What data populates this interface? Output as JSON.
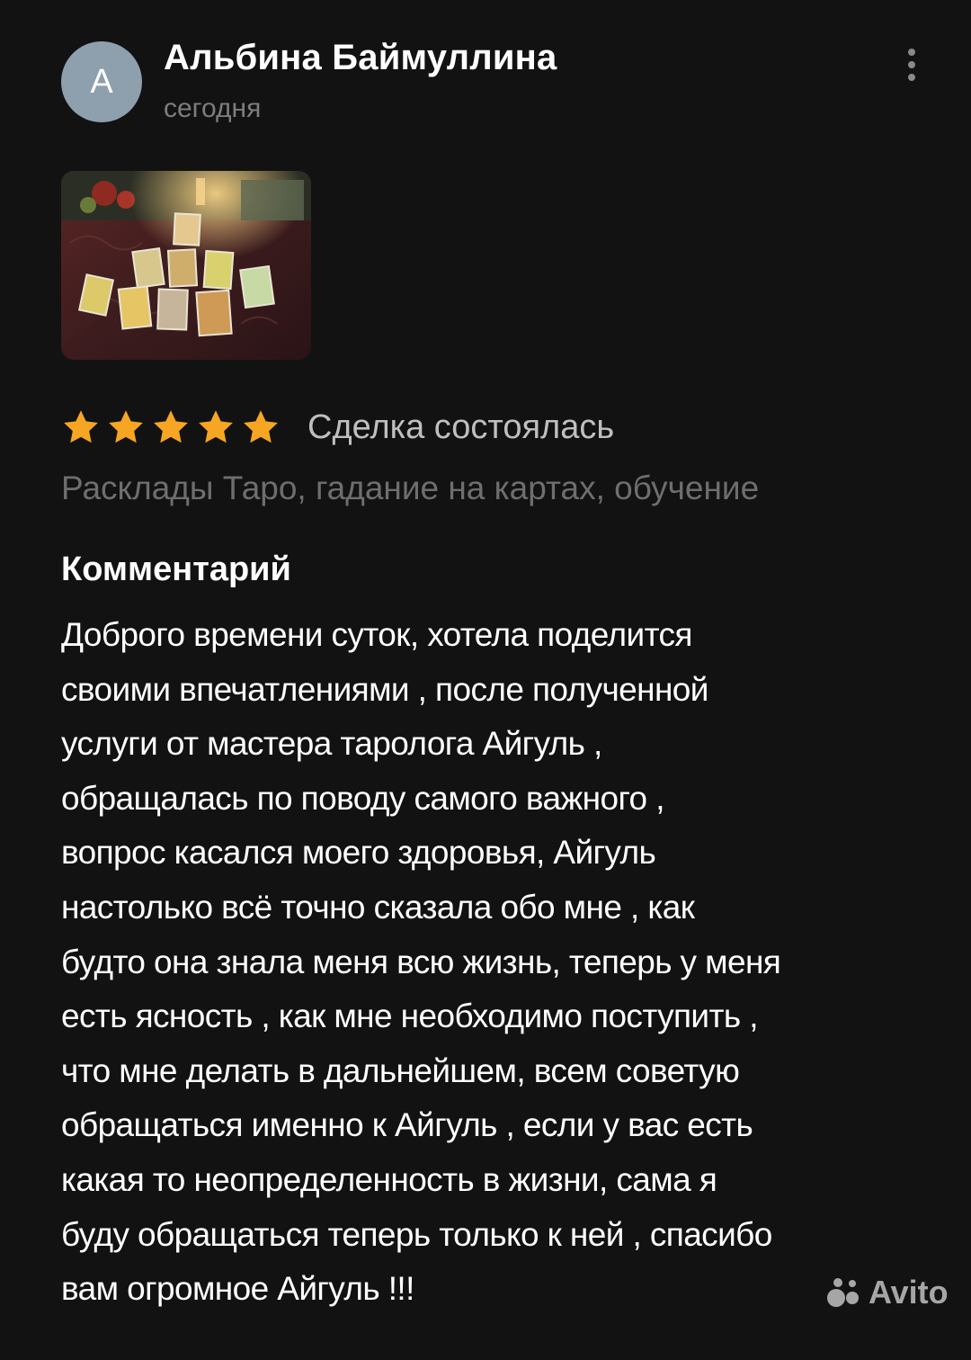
{
  "author": {
    "avatar_letter": "А",
    "name": "Альбина Баймуллина",
    "date": "сегодня"
  },
  "menu": {
    "icon": "more-vertical-icon"
  },
  "photo": {
    "description_icon": "tarot-photo"
  },
  "rating": {
    "value": 5,
    "max": 5,
    "color": "#f6a623"
  },
  "deal_status": "Сделка состоялась",
  "service": "Расклады Таро, гадание на картах, обучение",
  "comment": {
    "heading": "Комментарий",
    "lines": [
      "Доброго времени суток, хотела поделится",
      "своими впечатлениями , после полученной",
      "услуги от мастера таролога Айгуль ,",
      "обращалась по поводу самого важного ,",
      "вопрос касался моего здоровья, Айгуль",
      "настолько всё точно сказала обо мне , как",
      "будто она знала меня всю жизнь, теперь у меня",
      "есть ясность , как мне необходимо поступить ,",
      "что мне делать в дальнейшем, всем советую",
      "обращаться именно к Айгуль , если у вас есть",
      "какая то неопределенность в жизни, сама я",
      "буду обращаться теперь только к ней , спасибо",
      "вам огромное Айгуль !!!"
    ]
  },
  "watermark": "Avito"
}
